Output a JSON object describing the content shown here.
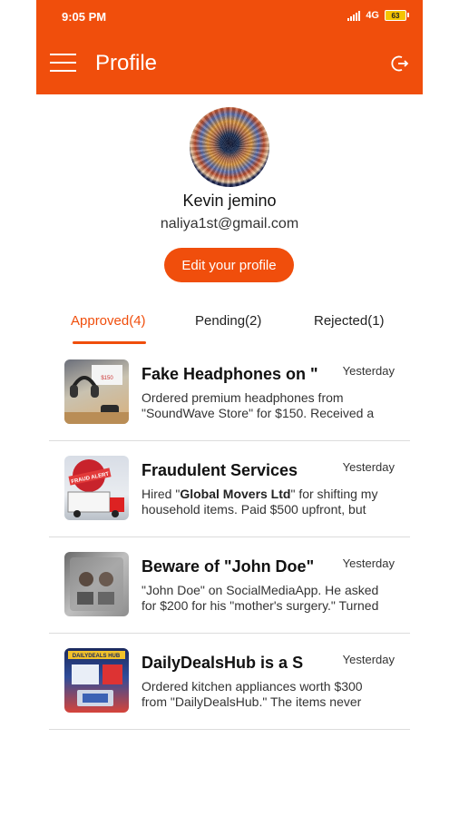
{
  "status_bar": {
    "time": "9:05 PM",
    "network": "4G",
    "battery": "63"
  },
  "header": {
    "title": "Profile"
  },
  "profile": {
    "name": "Kevin jemino",
    "email": "naliya1st@gmail.com",
    "edit_label": "Edit your profile"
  },
  "tabs": [
    {
      "label": "Approved(4)",
      "active": true
    },
    {
      "label": "Pending(2)",
      "active": false
    },
    {
      "label": "Rejected(1)",
      "active": false
    }
  ],
  "reports": [
    {
      "title": "Fake Headphones on \"",
      "date": "Yesterday",
      "desc": "Ordered premium headphones from \"SoundWave Store\" for $150. Received a",
      "thumb_text": "$150"
    },
    {
      "title": "Fraudulent Services",
      "date": "Yesterday",
      "desc_pre": "Hired \"",
      "desc_bold": "Global Movers Ltd",
      "desc_post": "\" for shifting my household items. Paid $500 upfront, but",
      "thumb_text": "FRAUD ALERT"
    },
    {
      "title": "Beware of \"John Doe\"",
      "date": "Yesterday",
      "desc": "\"John Doe\" on SocialMediaApp. He asked for $200 for his \"mother's surgery.\" Turned"
    },
    {
      "title": "DailyDealsHub is a S",
      "date": "Yesterday",
      "desc": "Ordered kitchen appliances worth $300 from \"DailyDealsHub.\" The items never",
      "thumb_text": "DAILYDEALS HUB"
    }
  ],
  "colors": {
    "accent": "#f04e0c"
  }
}
